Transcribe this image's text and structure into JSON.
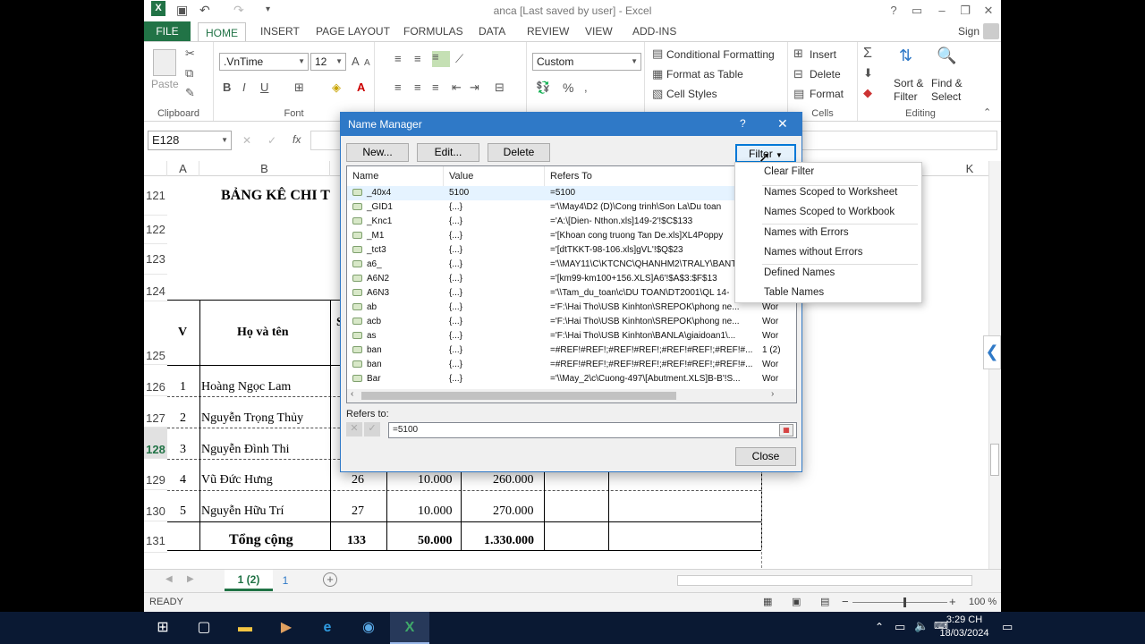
{
  "app": {
    "title": "anca [Last saved by user] - Excel",
    "sign_in": "Sign in",
    "help": "?",
    "qat_undo": "↶",
    "qat_redo": "↷"
  },
  "tabs": [
    "FILE",
    "HOME",
    "INSERT",
    "PAGE LAYOUT",
    "FORMULAS",
    "DATA",
    "REVIEW",
    "VIEW",
    "ADD-INS"
  ],
  "ribbon": {
    "clipboard": {
      "label": "Clipboard",
      "paste": "Paste"
    },
    "font": {
      "label": "Font",
      "name": ".VnTime",
      "size": "12",
      "grow": "A",
      "shrink": "A",
      "bold": "B",
      "italic": "I",
      "underline": "U"
    },
    "number": {
      "format": "Custom",
      "percent": "%"
    },
    "styles": {
      "conditional": "Conditional Formatting",
      "format_table": "Format as Table",
      "cell_styles": "Cell Styles"
    },
    "cells": {
      "label": "Cells",
      "insert": "Insert",
      "delete": "Delete",
      "format": "Format"
    },
    "editing": {
      "label": "Editing",
      "sort": "Sort &",
      "filter": "Filter",
      "find": "Find &",
      "select": "Select"
    }
  },
  "formula_bar": {
    "name_box": "E128",
    "fx": "fx"
  },
  "columns": [
    "A",
    "B",
    "K"
  ],
  "rows": {
    "numbers": [
      "121",
      "122",
      "123",
      "124",
      "125",
      "126",
      "127",
      "128",
      "129",
      "130",
      "131"
    ],
    "selected": "128"
  },
  "sheet": {
    "title": "BẢNG KÊ CHI T",
    "header_v": "V",
    "header_name": "Họ và tên",
    "header_s": "S",
    "people": [
      {
        "no": "1",
        "name": "Hoàng Ngọc Lam"
      },
      {
        "no": "2",
        "name": "Nguyễn Trọng Thủy"
      },
      {
        "no": "3",
        "name": "Nguyễn Đình Thi"
      },
      {
        "no": "4",
        "name": "Vũ Đức Hưng",
        "days": "26",
        "rate": "10.000",
        "amount": "260.000"
      },
      {
        "no": "5",
        "name": "Nguyễn Hữu Trí",
        "days": "27",
        "rate": "10.000",
        "amount": "270.000"
      }
    ],
    "total": {
      "label": "Tổng cộng",
      "days": "133",
      "rate": "50.000",
      "amount": "1.330.000"
    }
  },
  "sheet_tabs": [
    "1 (2)",
    "1"
  ],
  "status": {
    "ready": "READY",
    "zoom": "100 %",
    "minus": "−",
    "plus": "+"
  },
  "taskbar": {
    "time": "3:29 CH",
    "date": "18/03/2024"
  },
  "dialog": {
    "title": "Name Manager",
    "help": "?",
    "close_x": "✕",
    "new_btn": "New...",
    "edit_btn": "Edit...",
    "delete_btn": "Delete",
    "filter_btn": "Filter",
    "col_name": "Name",
    "col_value": "Value",
    "col_refers": "Refers To",
    "names": [
      {
        "name": "_40x4",
        "value": "5100",
        "refers": "=5100",
        "extra": ""
      },
      {
        "name": "_GID1",
        "value": "{...}",
        "refers": "='\\\\May4\\D2 (D)\\Cong trinh\\Son La\\Du toan",
        "extra": ""
      },
      {
        "name": "_Knc1",
        "value": "{...}",
        "refers": "='A:\\[Dien- Nthon.xls]149-2'!$C$133",
        "extra": ""
      },
      {
        "name": "_M1",
        "value": "{...}",
        "refers": "='[Khoan cong truong Tan De.xls]XL4Poppy",
        "extra": ""
      },
      {
        "name": "_tct3",
        "value": "{...}",
        "refers": "='[dtTKKT-98-106.xls]gVL'!$Q$23",
        "extra": ""
      },
      {
        "name": "a6_",
        "value": "{...}",
        "refers": "='\\\\MAY11\\C\\KTCNC\\QHANHM2\\TRALY\\BANT",
        "extra": ""
      },
      {
        "name": "A6N2",
        "value": "{...}",
        "refers": "='[km99-km100+156.XLS]A6'!$A$3:$F$13",
        "extra": ""
      },
      {
        "name": "A6N3",
        "value": "{...}",
        "refers": "='\\\\Tam_du_toan\\c\\DU TOAN\\DT2001\\QL 14-",
        "extra": ""
      },
      {
        "name": "ab",
        "value": "{...}",
        "refers": "='F:\\Hai Tho\\USB Kinhton\\SREPOK\\phong ne...",
        "extra": "Wor"
      },
      {
        "name": "acb",
        "value": "{...}",
        "refers": "='F:\\Hai Tho\\USB Kinhton\\SREPOK\\phong ne...",
        "extra": "Wor"
      },
      {
        "name": "as",
        "value": "{...}",
        "refers": "='F:\\Hai Tho\\USB Kinhton\\BANLA\\giaidoan1\\...",
        "extra": "Wor"
      },
      {
        "name": "ban",
        "value": "{...}",
        "refers": "=#REF!#REF!;#REF!#REF!;#REF!#REF!;#REF!#...",
        "extra": "1 (2)"
      },
      {
        "name": "ban",
        "value": "{...}",
        "refers": "=#REF!#REF!;#REF!#REF!;#REF!#REF!;#REF!#...",
        "extra": "Wor"
      },
      {
        "name": "Bar",
        "value": "{...}",
        "refers": "='\\\\May_2\\c\\Cuong-497\\[Abutment.XLS]B-B'!S...",
        "extra": "Wor"
      }
    ],
    "refers_label": "Refers to:",
    "refers_value": "=5100",
    "close_btn": "Close"
  },
  "filter_menu": [
    "Clear Filter",
    "Names Scoped to Worksheet",
    "Names Scoped to Workbook",
    "Names with Errors",
    "Names without Errors",
    "Defined Names",
    "Table Names"
  ]
}
